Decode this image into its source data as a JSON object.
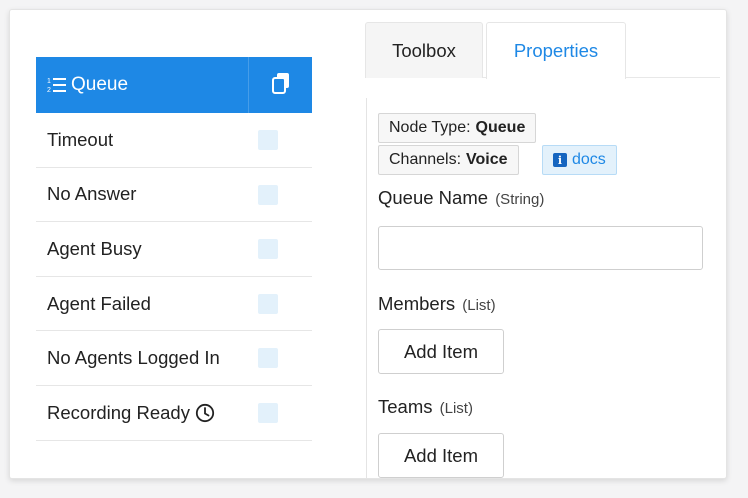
{
  "node": {
    "title": "Queue",
    "header_icon": "numbered-list-icon",
    "action_icon": "copy-icon",
    "ports": [
      {
        "label": "Timeout"
      },
      {
        "label": "No Answer"
      },
      {
        "label": "Agent Busy"
      },
      {
        "label": "Agent Failed"
      },
      {
        "label": "No Agents Logged In"
      },
      {
        "label": "Recording Ready",
        "icon": "clock-icon"
      }
    ]
  },
  "tabs": {
    "toolbox": "Toolbox",
    "properties": "Properties",
    "active": "Properties"
  },
  "properties": {
    "node_type_label": "Node Type:",
    "node_type_value": "Queue",
    "channels_label": "Channels:",
    "channels_value": "Voice",
    "docs_label": "docs",
    "queue_name_label": "Queue Name",
    "queue_name_type": "(String)",
    "queue_name_value": "",
    "members_label": "Members",
    "members_type": "(List)",
    "members_add": "Add Item",
    "teams_label": "Teams",
    "teams_type": "(List)",
    "teams_add": "Add Item"
  },
  "colors": {
    "accent": "#1e88e5",
    "port": "#e3f1fb"
  }
}
